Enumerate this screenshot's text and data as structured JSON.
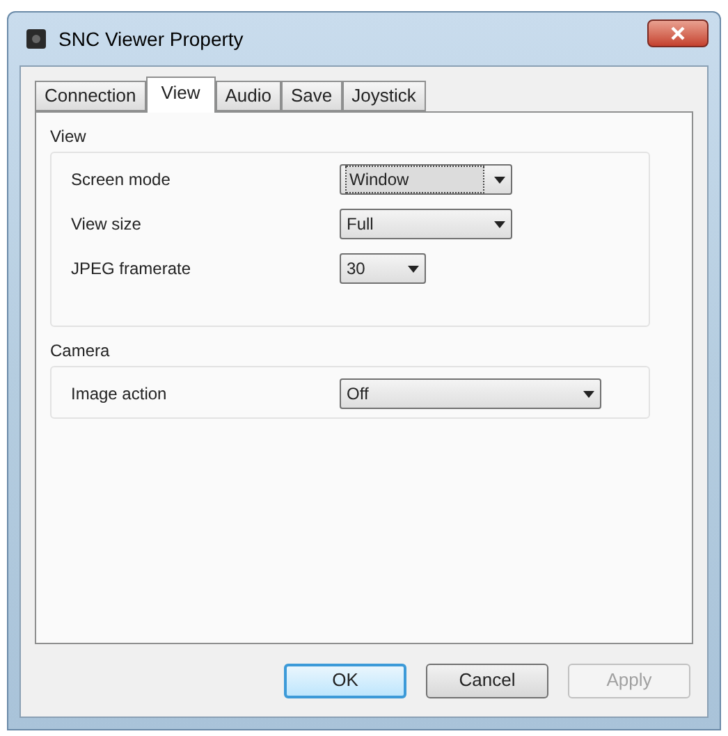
{
  "window": {
    "title": "SNC Viewer Property"
  },
  "tabs": [
    {
      "label": "Connection",
      "selected": false
    },
    {
      "label": "View",
      "selected": true
    },
    {
      "label": "Audio",
      "selected": false
    },
    {
      "label": "Save",
      "selected": false
    },
    {
      "label": "Joystick",
      "selected": false
    }
  ],
  "groups": [
    {
      "title": "View",
      "fields": [
        {
          "label": "Screen mode",
          "value": "Window",
          "focused": true
        },
        {
          "label": "View size",
          "value": "Full",
          "focused": false
        },
        {
          "label": "JPEG framerate",
          "value": "30",
          "focused": false
        }
      ]
    },
    {
      "title": "Camera",
      "fields": [
        {
          "label": "Image action",
          "value": "Off"
        }
      ]
    }
  ],
  "buttons": [
    {
      "label": "OK",
      "default": true,
      "disabled": false
    },
    {
      "label": "Cancel",
      "default": false,
      "disabled": false
    },
    {
      "label": "Apply",
      "default": false,
      "disabled": true
    }
  ]
}
